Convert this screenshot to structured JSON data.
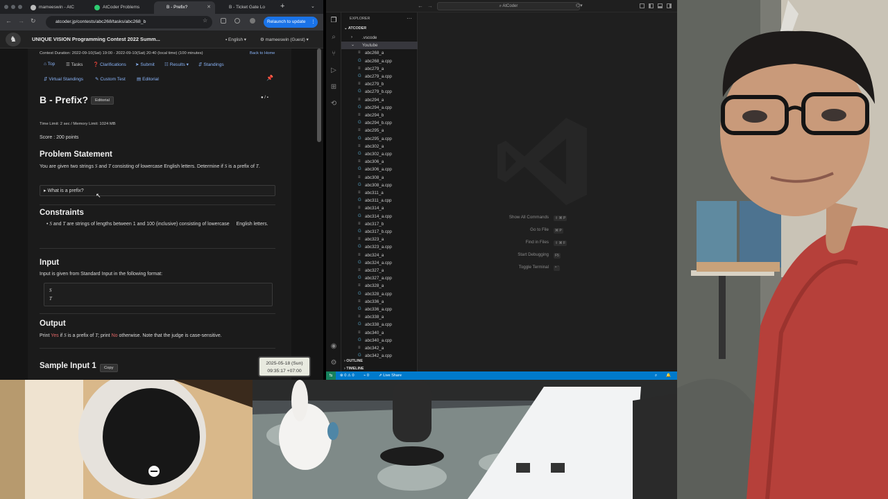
{
  "browser": {
    "tabs": [
      {
        "label": "mameeswin - AtC"
      },
      {
        "label": "AtCoder Problems"
      },
      {
        "label": "B - Prefix?"
      },
      {
        "label": "B - Ticket Gate Lo"
      }
    ],
    "url": "atcoder.jp/contests/abc268/tasks/abc268_b",
    "relaunch": "Relaunch to update",
    "site": {
      "contest_title": "UNIQUE VISION Programming Contest 2022 Summ...",
      "language": "English",
      "user": "mameeswin (Guest)",
      "duration": "Contest Duration: 2022-09-10(Sat) 19:00 - 2022-09-10(Sat) 20:40 (local time) (100 minutes)",
      "back_home": "Back to Home",
      "nav": [
        "Top",
        "Tasks",
        "Clarifications",
        "Submit",
        "Results",
        "Standings"
      ],
      "nav2": [
        "Virtual Standings",
        "Custom Test",
        "Editorial"
      ]
    },
    "task": {
      "title": "B - Prefix?",
      "editorial": "Editorial",
      "limits": "Time Limit: 2 sec / Memory Limit: 1024 MB",
      "score": "Score : 200 points",
      "problem_heading": "Problem Statement",
      "statement_1": "You are given two strings",
      "var_s": "S",
      "and": "and",
      "var_t": "T",
      "statement_2": "consisting of lowercase English letters. Determine if",
      "statement_3": "is a",
      "statement_4": "prefix of",
      "details_summary": "What is a prefix?",
      "constraints_heading": "Constraints",
      "constraint_1": "are strings of lengths between",
      "one": "1",
      "and2": "and",
      "hundred": "100",
      "constraint_2": "(inclusive) consisting of lowercase",
      "constraint_3": "English letters.",
      "input_heading": "Input",
      "input_text": "Input is given from Standard Input in the following format:",
      "output_heading": "Output",
      "out_print": "Print",
      "out_yes": "Yes",
      "out_if": "if",
      "out_is_prefix": "is a prefix of",
      "out_print2": "; print",
      "out_no": "No",
      "out_rest": "otherwise. Note that the judge is case-sensitive.",
      "sample_heading": "Sample Input 1",
      "copy": "Copy"
    },
    "clock": {
      "date": "2025-05-18 (Sun)",
      "time": "09:35:17 +07:00"
    }
  },
  "vscode": {
    "search": "AtCoder",
    "explorer": "EXPLORER",
    "root": "ATCODER",
    "folders": [
      ".vscode",
      "Youtube"
    ],
    "files": [
      "abc268_a",
      "abc268_a.cpp",
      "abc279_a",
      "abc279_a.cpp",
      "abc279_b",
      "abc279_b.cpp",
      "abc294_a",
      "abc294_a.cpp",
      "abc294_b",
      "abc294_b.cpp",
      "abc295_a",
      "abc295_a.cpp",
      "abc302_a",
      "abc302_a.cpp",
      "abc306_a",
      "abc306_a.cpp",
      "abc308_a",
      "abc308_a.cpp",
      "abc311_a",
      "abc311_a.cpp",
      "abc314_a",
      "abc314_a.cpp",
      "abc317_b",
      "abc317_b.cpp",
      "abc323_a",
      "abc323_a.cpp",
      "abc324_a",
      "abc324_a.cpp",
      "abc327_a",
      "abc327_a.cpp",
      "abc328_a",
      "abc328_a.cpp",
      "abc336_a",
      "abc336_a.cpp",
      "abc338_a",
      "abc338_a.cpp",
      "abc340_a",
      "abc340_a.cpp",
      "abc342_a",
      "abc342_a.cpp"
    ],
    "outline": "OUTLINE",
    "timeline": "TIMELINE",
    "hints": [
      {
        "label": "Show All Commands",
        "keys": "⇧ ⌘ P"
      },
      {
        "label": "Go to File",
        "keys": "⌘ P"
      },
      {
        "label": "Find in Files",
        "keys": "⇧ ⌘ F"
      },
      {
        "label": "Start Debugging",
        "keys": "F5"
      },
      {
        "label": "Toggle Terminal",
        "keys": "^ `"
      }
    ],
    "status": {
      "errors": "0",
      "warnings": "0",
      "ports": "0",
      "live_share": "Live Share"
    }
  }
}
